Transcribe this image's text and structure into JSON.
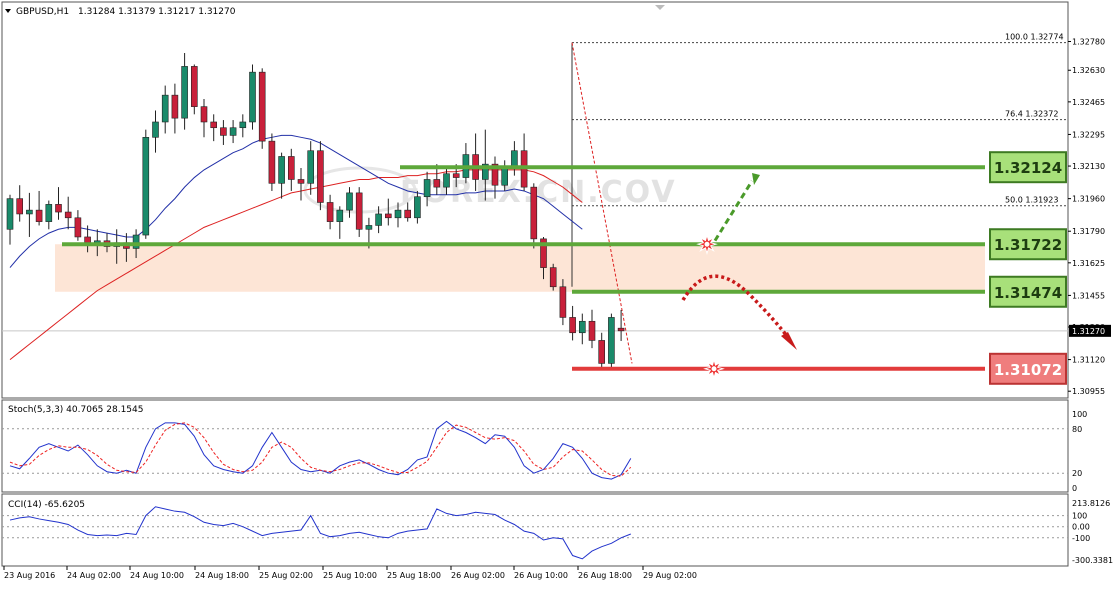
{
  "header": {
    "symbol": "GBPUSD,H1",
    "ohlc": "1.31284 1.31379 1.31217 1.31270",
    "menu_icon": "triangle-down-icon"
  },
  "watermark": "FOREX.CN.COV",
  "colors": {
    "bull": "#1a8a6a",
    "bear": "#c8203a",
    "ma_fast": "#2230a8",
    "ma_slow": "#dd2222",
    "level_green": "#5ea83a",
    "level_red": "#e23b3b",
    "zone_fill": "#fde5d6",
    "stoch_main": "#2233cc",
    "stoch_signal": "#ee2222",
    "cci": "#2233cc"
  },
  "chart_data": [
    {
      "type": "candlestick",
      "symbol": "GBPUSD",
      "timeframe": "H1",
      "ylim": [
        1.3093,
        1.3284
      ],
      "yticks": [
        "1.32780",
        "1.32630",
        "1.32465",
        "1.32295",
        "1.32130",
        "1.31960",
        "1.31790",
        "1.31625",
        "1.31455",
        "1.31290",
        "1.31120",
        "1.30955"
      ],
      "xticks": [
        "23 Aug 2016",
        "24 Aug 02:00",
        "24 Aug 10:00",
        "24 Aug 18:00",
        "25 Aug 02:00",
        "25 Aug 10:00",
        "25 Aug 18:00",
        "26 Aug 02:00",
        "26 Aug 10:00",
        "26 Aug 18:00",
        "29 Aug 02:00"
      ],
      "current_price": "1.31270",
      "current_price_value": 1.3127,
      "candles": [
        [
          1.318,
          1.3198,
          1.3172,
          1.3196
        ],
        [
          1.3196,
          1.3203,
          1.3184,
          1.3188
        ],
        [
          1.3188,
          1.3199,
          1.3176,
          1.319
        ],
        [
          1.319,
          1.32,
          1.3182,
          1.3184
        ],
        [
          1.3184,
          1.3195,
          1.318,
          1.3193
        ],
        [
          1.3193,
          1.3202,
          1.3185,
          1.3189
        ],
        [
          1.3189,
          1.3197,
          1.318,
          1.3186
        ],
        [
          1.3186,
          1.319,
          1.3174,
          1.3176
        ],
        [
          1.3176,
          1.3182,
          1.3168,
          1.3173
        ],
        [
          1.3173,
          1.318,
          1.3166,
          1.3174
        ],
        [
          1.3174,
          1.3178,
          1.3168,
          1.3171
        ],
        [
          1.3171,
          1.318,
          1.3162,
          1.3173
        ],
        [
          1.3173,
          1.3178,
          1.3163,
          1.317
        ],
        [
          1.317,
          1.318,
          1.3165,
          1.3177
        ],
        [
          1.3177,
          1.3232,
          1.3175,
          1.3228
        ],
        [
          1.3228,
          1.3242,
          1.322,
          1.3236
        ],
        [
          1.3236,
          1.3255,
          1.323,
          1.325
        ],
        [
          1.325,
          1.3256,
          1.323,
          1.3238
        ],
        [
          1.3238,
          1.3272,
          1.3232,
          1.3265
        ],
        [
          1.3265,
          1.3266,
          1.324,
          1.3244
        ],
        [
          1.3244,
          1.3248,
          1.3228,
          1.3236
        ],
        [
          1.3236,
          1.324,
          1.3226,
          1.3233
        ],
        [
          1.3233,
          1.3237,
          1.3224,
          1.3229
        ],
        [
          1.3229,
          1.3237,
          1.3225,
          1.3233
        ],
        [
          1.3233,
          1.324,
          1.3228,
          1.3236
        ],
        [
          1.3236,
          1.3266,
          1.3232,
          1.3262
        ],
        [
          1.3262,
          1.3264,
          1.3222,
          1.3226
        ],
        [
          1.3226,
          1.323,
          1.32,
          1.3204
        ],
        [
          1.3204,
          1.322,
          1.3196,
          1.3218
        ],
        [
          1.3218,
          1.3222,
          1.32,
          1.3206
        ],
        [
          1.3206,
          1.3212,
          1.3195,
          1.3204
        ],
        [
          1.3204,
          1.3226,
          1.3198,
          1.3221
        ],
        [
          1.3221,
          1.3226,
          1.319,
          1.3194
        ],
        [
          1.3194,
          1.3198,
          1.318,
          1.3184
        ],
        [
          1.3184,
          1.3192,
          1.3175,
          1.319
        ],
        [
          1.319,
          1.3202,
          1.3186,
          1.3199
        ],
        [
          1.3199,
          1.3202,
          1.3176,
          1.318
        ],
        [
          1.318,
          1.3186,
          1.317,
          1.3182
        ],
        [
          1.3182,
          1.3192,
          1.3178,
          1.3188
        ],
        [
          1.3188,
          1.3196,
          1.3182,
          1.3186
        ],
        [
          1.3186,
          1.3194,
          1.3181,
          1.319
        ],
        [
          1.319,
          1.3194,
          1.3184,
          1.3186
        ],
        [
          1.3186,
          1.32,
          1.3183,
          1.3197
        ],
        [
          1.3197,
          1.321,
          1.3192,
          1.3206
        ],
        [
          1.3206,
          1.3214,
          1.3198,
          1.3202
        ],
        [
          1.3202,
          1.3212,
          1.3198,
          1.3209
        ],
        [
          1.3209,
          1.3214,
          1.3202,
          1.3207
        ],
        [
          1.3207,
          1.3225,
          1.3204,
          1.3219
        ],
        [
          1.3219,
          1.323,
          1.32,
          1.3206
        ],
        [
          1.3206,
          1.3232,
          1.3195,
          1.3214
        ],
        [
          1.3214,
          1.3218,
          1.3196,
          1.3203
        ],
        [
          1.3203,
          1.3216,
          1.32,
          1.3213
        ],
        [
          1.3213,
          1.3226,
          1.3208,
          1.3221
        ],
        [
          1.3221,
          1.323,
          1.32,
          1.3202
        ],
        [
          1.3202,
          1.3204,
          1.317,
          1.3175
        ],
        [
          1.3175,
          1.3176,
          1.3154,
          1.316
        ],
        [
          1.316,
          1.3162,
          1.3148,
          1.315
        ],
        [
          1.315,
          1.3154,
          1.313,
          1.3134
        ],
        [
          1.3134,
          1.314,
          1.3122,
          1.3126
        ],
        [
          1.3126,
          1.3136,
          1.312,
          1.3132
        ],
        [
          1.3132,
          1.3138,
          1.3118,
          1.3122
        ],
        [
          1.3122,
          1.3126,
          1.3108,
          1.311
        ],
        [
          1.311,
          1.3136,
          1.3108,
          1.3134
        ],
        [
          1.31284,
          1.31379,
          1.31217,
          1.3127
        ]
      ],
      "moving_average_fast": [
        1.316,
        1.3166,
        1.3171,
        1.3175,
        1.3178,
        1.318,
        1.3181,
        1.3181,
        1.318,
        1.3179,
        1.3178,
        1.3177,
        1.3176,
        1.3176,
        1.318,
        1.3185,
        1.3191,
        1.3196,
        1.3202,
        1.3207,
        1.3211,
        1.3214,
        1.3217,
        1.322,
        1.3222,
        1.3225,
        1.3227,
        1.3228,
        1.3229,
        1.3229,
        1.3228,
        1.3227,
        1.3225,
        1.3222,
        1.3219,
        1.3216,
        1.3213,
        1.321,
        1.3207,
        1.3204,
        1.3202,
        1.32,
        1.3199,
        1.3198,
        1.3198,
        1.3198,
        1.3198,
        1.3199,
        1.3199,
        1.32,
        1.32,
        1.32,
        1.3201,
        1.32,
        1.3198,
        1.3196,
        1.3192,
        1.3188,
        1.3184,
        1.318
      ],
      "moving_average_slow": [
        1.3112,
        1.3116,
        1.312,
        1.3124,
        1.3128,
        1.3132,
        1.3136,
        1.314,
        1.3144,
        1.3148,
        1.3151,
        1.3154,
        1.3157,
        1.316,
        1.3163,
        1.3166,
        1.3169,
        1.3172,
        1.3175,
        1.3178,
        1.3181,
        1.3183,
        1.3185,
        1.3187,
        1.3189,
        1.3191,
        1.3193,
        1.3195,
        1.3197,
        1.3199,
        1.32,
        1.3201,
        1.3202,
        1.3203,
        1.3204,
        1.3205,
        1.3206,
        1.3206,
        1.3207,
        1.3207,
        1.3207,
        1.3208,
        1.3208,
        1.3209,
        1.3209,
        1.321,
        1.321,
        1.3211,
        1.3211,
        1.3211,
        1.3211,
        1.3211,
        1.3211,
        1.3211,
        1.321,
        1.3208,
        1.3205,
        1.3202,
        1.3198,
        1.3194
      ],
      "fibonacci": [
        {
          "label": "100.0",
          "price": "1.32774",
          "value": 1.32774
        },
        {
          "label": "76.4",
          "price": "1.32372",
          "value": 1.32372
        },
        {
          "label": "50.0",
          "price": "1.31923",
          "value": 1.31923
        }
      ],
      "levels": [
        {
          "label": "1.32124",
          "value": 1.32124,
          "role": "resistance"
        },
        {
          "label": "1.31722",
          "value": 1.31722,
          "role": "support-zone-top"
        },
        {
          "label": "1.31474",
          "value": 1.31474,
          "role": "support-zone-bottom"
        },
        {
          "label": "1.31072",
          "value": 1.31072,
          "role": "target"
        }
      ],
      "zone": [
        1.31474,
        1.31722
      ],
      "scenario_arrows": [
        {
          "type": "dashed-up",
          "color": "green",
          "from": 1.3172,
          "to": 1.32
        },
        {
          "type": "dotted-down",
          "color": "red",
          "from": 1.315,
          "to": 1.313
        }
      ]
    },
    {
      "type": "line",
      "name": "Stoch(5,3,3)",
      "label": "Stoch(5,3,3) 40.7065 28.1545",
      "ylim": [
        0,
        100
      ],
      "yticks": [
        "100",
        "80",
        "20",
        "0"
      ],
      "series": [
        {
          "name": "main",
          "values": [
            30,
            26,
            40,
            55,
            60,
            55,
            50,
            58,
            45,
            30,
            22,
            20,
            24,
            20,
            55,
            80,
            88,
            88,
            86,
            70,
            45,
            30,
            25,
            22,
            20,
            30,
            55,
            75,
            55,
            35,
            25,
            22,
            24,
            20,
            30,
            35,
            38,
            32,
            25,
            20,
            18,
            25,
            38,
            42,
            80,
            90,
            80,
            75,
            68,
            60,
            72,
            70,
            55,
            30,
            20,
            25,
            40,
            60,
            55,
            40,
            20,
            14,
            12,
            18,
            40
          ]
        },
        {
          "name": "signal",
          "values": [
            35,
            30,
            32,
            44,
            52,
            57,
            55,
            55,
            52,
            44,
            32,
            24,
            22,
            21,
            35,
            58,
            78,
            86,
            88,
            82,
            68,
            48,
            32,
            25,
            22,
            24,
            35,
            55,
            62,
            55,
            40,
            28,
            24,
            22,
            25,
            30,
            34,
            34,
            30,
            25,
            21,
            21,
            28,
            36,
            55,
            75,
            85,
            82,
            75,
            68,
            66,
            68,
            64,
            50,
            32,
            25,
            28,
            42,
            52,
            50,
            38,
            25,
            17,
            16,
            28
          ]
        }
      ]
    },
    {
      "type": "line",
      "name": "CCI(14)",
      "label": "CCI(14) -65.6205",
      "ylim": [
        -300.3381,
        213.8126
      ],
      "yticks": [
        "213.8126",
        "100",
        "0.00",
        "-100",
        "-300.3381"
      ],
      "series": [
        {
          "name": "CCI",
          "values": [
            60,
            80,
            90,
            70,
            55,
            40,
            20,
            -30,
            -70,
            -80,
            -75,
            -80,
            -60,
            -70,
            100,
            180,
            160,
            140,
            130,
            90,
            40,
            20,
            10,
            30,
            0,
            -40,
            -80,
            -60,
            -50,
            -40,
            -30,
            100,
            -60,
            -90,
            -80,
            -60,
            -50,
            -70,
            -90,
            -100,
            -60,
            -40,
            -30,
            -20,
            160,
            120,
            100,
            110,
            130,
            120,
            110,
            60,
            20,
            -40,
            -60,
            -120,
            -100,
            -110,
            -260,
            -290,
            -220,
            -180,
            -150,
            -100,
            -65.6205
          ]
        }
      ]
    }
  ]
}
